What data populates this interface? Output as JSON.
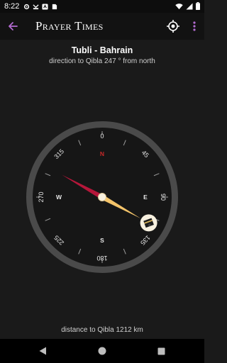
{
  "status_bar": {
    "time": "8:22",
    "icons": [
      "settings-icon",
      "missed-call-icon",
      "app-icon",
      "sd-card-icon"
    ],
    "right_icons": [
      "wifi-icon",
      "signal-icon",
      "battery-icon"
    ]
  },
  "app_bar": {
    "title": "Prayer Times",
    "back_icon": "arrow-back-icon",
    "location_icon": "gps-icon",
    "menu_icon": "more-vert-icon"
  },
  "qibla": {
    "location": "Tubli - Bahrain",
    "direction_text": "direction to Qibla 247 ° from north",
    "distance_text": "distance to Qibla 1212 km",
    "bearing_deg": 247,
    "needle_heading_deg": -61
  },
  "compass": {
    "degree_labels": [
      "0",
      "45",
      "90",
      "135",
      "180",
      "225",
      "270",
      "315"
    ],
    "cardinal_labels": [
      "N",
      "E",
      "S",
      "W"
    ],
    "colors": {
      "north_marker": "#c62828",
      "needle_north": "#b5173a",
      "needle_south": "#f4c46a",
      "ring": "#4a4a4a",
      "face": "#161616"
    }
  },
  "nav_bar": {
    "icons": [
      "nav-back-icon",
      "nav-home-icon",
      "nav-recents-icon"
    ]
  }
}
